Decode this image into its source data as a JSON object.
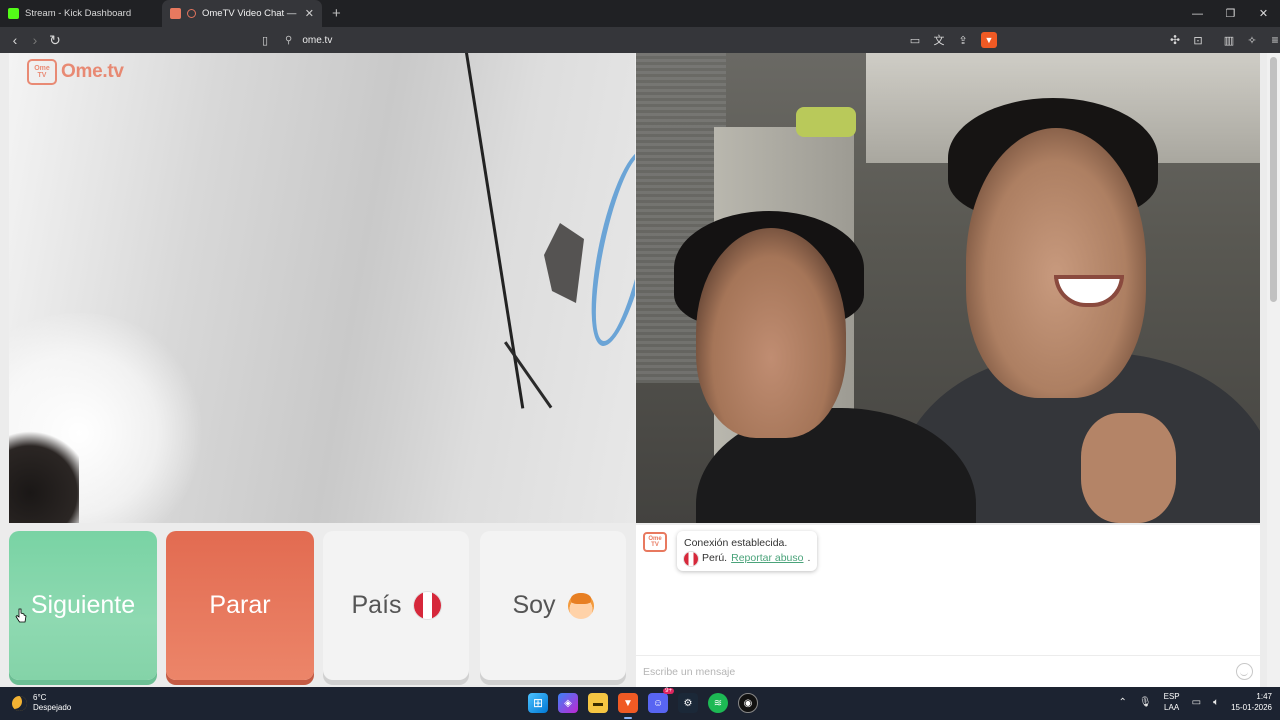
{
  "browser": {
    "tabs": [
      {
        "title": "Stream - Kick Dashboard",
        "favicon_color": "#53fc18",
        "active": false
      },
      {
        "title": "OmeTV Video Chat — Omegl",
        "favicon_color": "#e8795f",
        "active": true
      }
    ],
    "url": "ome.tv",
    "window_controls": [
      "—",
      "❐",
      "✕"
    ]
  },
  "brand": {
    "logo_small": "Ome TV",
    "logo_word": "Ome.tv",
    "color": "#e8795f"
  },
  "controls": {
    "next_label": "Siguiente",
    "stop_label": "Parar",
    "country_label": "País",
    "gender_label": "Soy",
    "next_color": "#7ed5a8",
    "stop_color": "#e57558",
    "selected_country_flag": "peru-flag-icon"
  },
  "chat": {
    "status_line": "Conexión establecida.",
    "country": "Perú.",
    "report_link": "Reportar abuso",
    "report_suffix": ".",
    "input_placeholder": "Escribe un mensaje"
  },
  "taskbar": {
    "temperature": "6°C",
    "weather": "Despejado",
    "language": "ESP",
    "layout": "LAA",
    "time": "1:47",
    "date": "15-01-2026",
    "discord_badge": "9+"
  }
}
